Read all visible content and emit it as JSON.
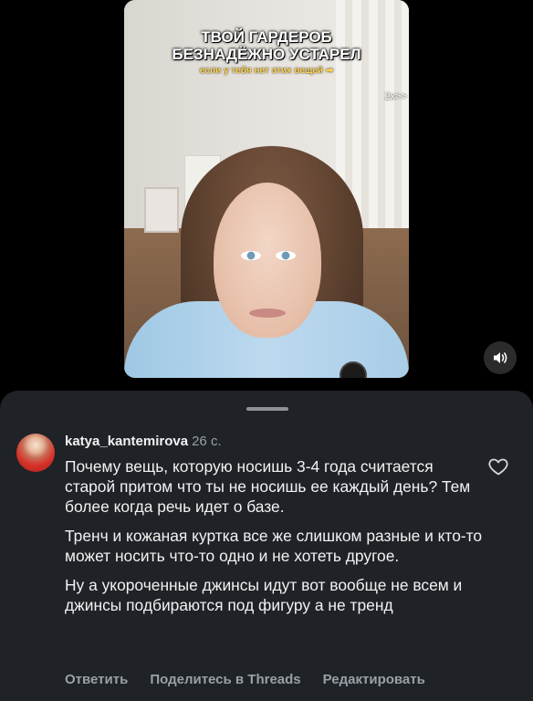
{
  "video": {
    "title_line1": "ТВОЙ ГАРДЕРОБ",
    "title_line2": "БЕЗНАДЁЖНО УСТАРЕЛ",
    "subtitle": "если у тебя нет этих вещей ➡",
    "speed": "2x>>"
  },
  "sound_button": {
    "icon": "speaker-icon"
  },
  "comment": {
    "username": "katya_kantemirova",
    "time": "26 с.",
    "paragraphs": [
      "Почему вещь, которую носишь 3-4 года считается старой притом что ты не носишь ее каждый день? Тем более когда речь идет о базе.",
      "Тренч и кожаная куртка все же слишком разные и кто-то может носить что-то одно и не хотеть другое.",
      "Ну а укороченные джинсы идут вот вообще не всем и джинсы подбираются под фигуру а не тренд"
    ]
  },
  "actions": {
    "reply": "Ответить",
    "share": "Поделитесь в Threads",
    "edit": "Редактировать"
  },
  "colors": {
    "background": "#000000",
    "sheet": "#1f2227",
    "muted_text": "#9aa0a6",
    "caption_yellow": "#ffd34a"
  }
}
